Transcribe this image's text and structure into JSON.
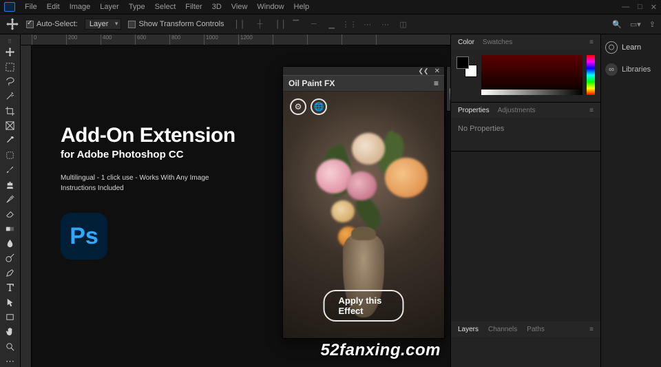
{
  "menubar": {
    "items": [
      "File",
      "Edit",
      "Image",
      "Layer",
      "Type",
      "Select",
      "Filter",
      "3D",
      "View",
      "Window",
      "Help"
    ]
  },
  "optbar": {
    "auto_select_label": "Auto-Select:",
    "auto_select_value": "Layer",
    "show_controls_label": "Show Transform Controls"
  },
  "ruler": {
    "marks": [
      "0",
      "200",
      "400",
      "600",
      "800",
      "1000",
      "1200"
    ]
  },
  "promo": {
    "title": "Add-On Extension",
    "subtitle": "for Adobe Photoshop CC",
    "line1": "Multilingual - 1 click use - Works With Any Image",
    "line2": "Instructions Included",
    "badge": "Ps"
  },
  "extension": {
    "title": "Oil Paint FX",
    "apply_label": "Apply this Effect"
  },
  "panels": {
    "color_tab": "Color",
    "swatches_tab": "Swatches",
    "properties_tab": "Properties",
    "adjustments_tab": "Adjustments",
    "no_properties": "No Properties",
    "layers_tab": "Layers",
    "channels_tab": "Channels",
    "paths_tab": "Paths",
    "learn": "Learn",
    "libraries": "Libraries"
  },
  "watermark": "52fanxing.com"
}
